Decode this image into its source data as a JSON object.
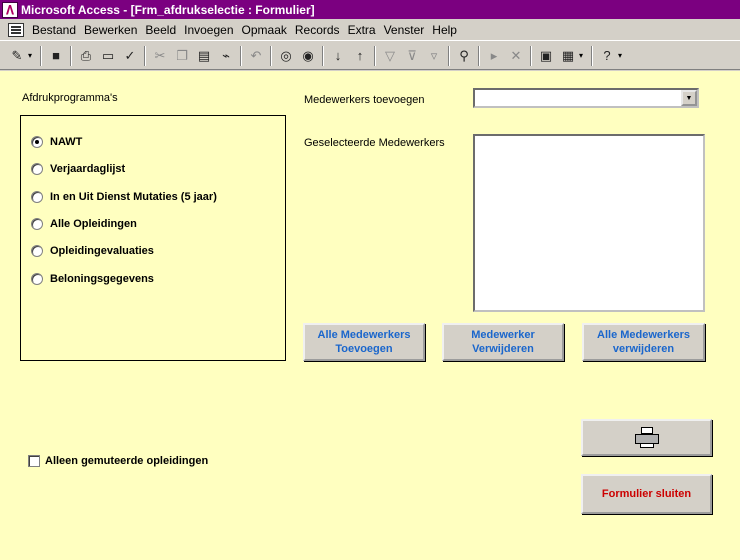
{
  "window": {
    "title": "Microsoft Access - [Frm_afdrukselectie : Formulier]"
  },
  "menu": [
    "Bestand",
    "Bewerken",
    "Beeld",
    "Invoegen",
    "Opmaak",
    "Records",
    "Extra",
    "Venster",
    "Help"
  ],
  "form": {
    "programs_label": "Afdrukprogramma's",
    "options": [
      {
        "label": "NAWT",
        "selected": true
      },
      {
        "label": "Verjaardaglijst",
        "selected": false
      },
      {
        "label": "In en Uit Dienst Mutaties (5 jaar)",
        "selected": false
      },
      {
        "label": "Alle Opleidingen",
        "selected": false
      },
      {
        "label": "Opleidingevaluaties",
        "selected": false
      },
      {
        "label": "Beloningsgegevens",
        "selected": false
      }
    ],
    "add_employees_label": "Medewerkers toevoegen",
    "add_employees_value": "",
    "selected_employees_label": "Geselecteerde Medewerkers",
    "selected_employees": [],
    "buttons": {
      "add_all": "Alle Medewerkers\nToevoegen",
      "remove_one": "Medewerker\nVerwijderen",
      "remove_all": "Alle Medewerkers\nverwijderen",
      "close": "Formulier sluiten"
    },
    "checkbox": {
      "label": "Alleen gemuteerde opleidingen",
      "checked": false
    }
  },
  "colors": {
    "titlebar": "#7b0080",
    "form_bg": "#ffffc0",
    "button_text_blue": "#1a66cc",
    "button_text_red": "#cc0000"
  }
}
